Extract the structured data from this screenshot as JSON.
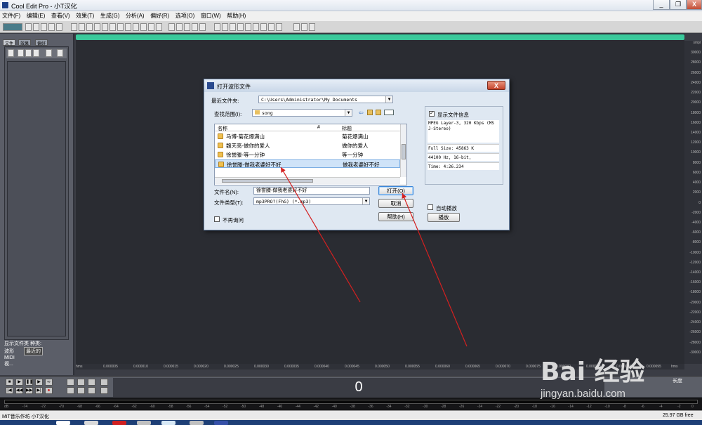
{
  "window": {
    "title": "Cool Edit Pro  - 小T汉化",
    "minimize": "_",
    "restore": "❐",
    "close": "X"
  },
  "menu": [
    "文件(F)",
    "编辑(E)",
    "查看(V)",
    "效果(T)",
    "生成(G)",
    "分析(A)",
    "偏好(R)",
    "选项(O)",
    "窗口(W)",
    "帮助(H)"
  ],
  "left_panel": {
    "tabs": [
      "文件",
      "效果",
      "偏好"
    ],
    "show_types_label": "显示文件类",
    "types_label": "种类:",
    "type_items": [
      "波形",
      "MIDI",
      "视..."
    ],
    "sort_value": "最近的"
  },
  "ruler_right": [
    "smpl",
    "30000",
    "28000",
    "26000",
    "24000",
    "22000",
    "20000",
    "18000",
    "16000",
    "14000",
    "12000",
    "10000",
    "8000",
    "6000",
    "4000",
    "2000",
    "0",
    "-2000",
    "-4000",
    "-6000",
    "-8000",
    "-10000",
    "-12000",
    "-14000",
    "-16000",
    "-18000",
    "-20000",
    "-22000",
    "-24000",
    "-26000",
    "-28000",
    "-30000"
  ],
  "ruler_bottom": [
    "hms",
    "0.000005",
    "0.000010",
    "0.000015",
    "0.000020",
    "0.000025",
    "0.000030",
    "0.000035",
    "0.000040",
    "0.000045",
    "0.000050",
    "0.000055",
    "0.000060",
    "0.000065",
    "0.000070",
    "0.000075",
    "0.000080",
    "0.000085",
    "0.000090",
    "0.000095",
    "hms"
  ],
  "transport": {
    "time": "0",
    "length_label": "长度",
    "row1": [
      "■",
      "▶",
      "❚❚",
      "▶",
      "∞"
    ],
    "row2": [
      "|◀",
      "◀◀",
      "▶▶",
      "▶|",
      "●"
    ]
  },
  "levels_scale": [
    "dB",
    "-74",
    "-72",
    "-70",
    "-68",
    "-66",
    "-64",
    "-62",
    "-60",
    "-58",
    "-56",
    "-54",
    "-52",
    "-50",
    "-48",
    "-46",
    "-44",
    "-42",
    "-40",
    "-38",
    "-36",
    "-34",
    "-32",
    "-30",
    "-28",
    "-26",
    "-24",
    "-22",
    "-20",
    "-18",
    "-16",
    "-14",
    "-12",
    "-10",
    "-8",
    "-6",
    "-4",
    "-2",
    "0"
  ],
  "status": {
    "left": "MiT音乐作坊 小T汉化",
    "right": "25.97 GB free"
  },
  "dialog": {
    "title": "打开波形文件",
    "close": "X",
    "recent_label": "最近文件夹:",
    "recent_value": "C:\\Users\\Administrator\\My Documents",
    "lookin_label": "查找范围(I):",
    "lookin_value": "song",
    "columns": [
      "名称",
      "#",
      "标题"
    ],
    "files": [
      {
        "name": "马博-菊花爆满山",
        "title": "菊花爆满山"
      },
      {
        "name": "魏天亮-做你的爱人",
        "title": "做你的爱人"
      },
      {
        "name": "徐誉滕-等一分钟",
        "title": "等一分钟"
      },
      {
        "name": "徐誉滕-做我老婆好不好",
        "title": "做我老婆好不好"
      }
    ],
    "filename_label": "文件名(N):",
    "filename_value": "徐誉滕-做我老婆好不好",
    "filetype_label": "文件类型(T):",
    "filetype_value": "mp3PRO?(FhG) (*.mp3)",
    "dont_ask": "不再询问",
    "open_button": "打开(O)",
    "cancel_button": "取消",
    "help_button": "帮助(H)",
    "show_info_label": "显示文件信息",
    "info_text": "MPEG Layer-3, 320 Kbps (MS J-Stereo)",
    "info_size": "Full Size: 45863 K",
    "info_format": "44100 Hz, 16-bit,",
    "info_time": "Time:   4:26.234",
    "autoplay_label": "自动播放",
    "play_button": "播放"
  },
  "watermark": {
    "brand": "Bai 经验",
    "url": "jingyan.baidu.com"
  },
  "colors": {
    "wave_bg": "#2a2c32",
    "wave_bar": "#3ac99b",
    "annotation_arrow": "#d42020"
  }
}
